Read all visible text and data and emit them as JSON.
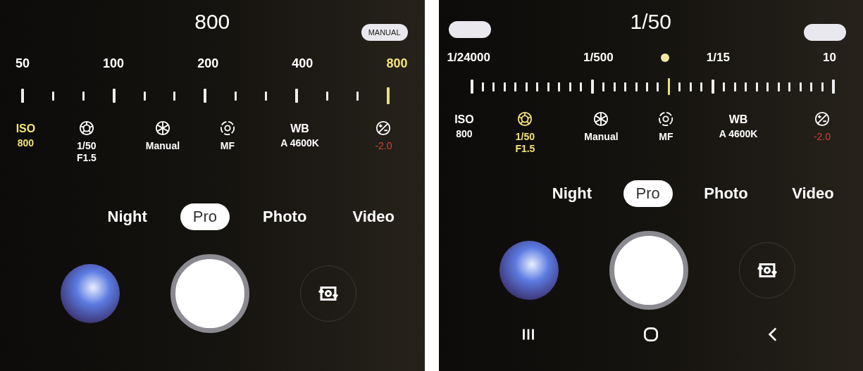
{
  "screens": [
    {
      "title": "800",
      "left_pill": false,
      "right_pill": true,
      "right_pill_label": "MANUAL",
      "scale": {
        "kind": "iso",
        "level": 1.0,
        "labels": [
          {
            "text": "50",
            "selected": false
          },
          {
            "text": "100",
            "selected": false
          },
          {
            "text": "200",
            "selected": false
          },
          {
            "text": "400",
            "selected": false
          },
          {
            "text": "800",
            "selected": true
          }
        ]
      },
      "settings": [
        {
          "kind": "text",
          "label": "ISO",
          "values": [
            "800"
          ],
          "selected": true,
          "alert": false
        },
        {
          "kind": "aperture",
          "values": [
            "1/50",
            "F1.5"
          ],
          "selected": false,
          "alert": false
        },
        {
          "kind": "wheel",
          "values": [
            "Manual"
          ],
          "selected": false,
          "alert": false
        },
        {
          "kind": "focus",
          "values": [
            "MF"
          ],
          "selected": false,
          "alert": false
        },
        {
          "kind": "text",
          "label": "WB",
          "values": [
            "A 4600K"
          ],
          "selected": false,
          "alert": false
        },
        {
          "kind": "exposure",
          "values": [
            "-2.0"
          ],
          "selected": false,
          "alert": true
        }
      ],
      "modes": [
        {
          "label": "Night",
          "selected": false
        },
        {
          "label": "Pro",
          "selected": true
        },
        {
          "label": "Photo",
          "selected": false
        },
        {
          "label": "Video",
          "selected": false
        }
      ],
      "nav_bar": false
    },
    {
      "title": "1/50",
      "left_pill": true,
      "right_pill": true,
      "scale": {
        "kind": "shutter",
        "level": 0.55,
        "labels": [
          {
            "text": "1/24000",
            "selected": false
          },
          {
            "text": "1/500",
            "selected": false
          },
          {
            "text": "1/15",
            "selected": false
          },
          {
            "text": "10",
            "selected": false
          }
        ]
      },
      "settings": [
        {
          "kind": "text",
          "label": "ISO",
          "values": [
            "800"
          ],
          "selected": false,
          "alert": false
        },
        {
          "kind": "aperture",
          "values": [
            "1/50",
            "F1.5"
          ],
          "selected": true,
          "alert": false
        },
        {
          "kind": "wheel",
          "values": [
            "Manual"
          ],
          "selected": false,
          "alert": false
        },
        {
          "kind": "focus",
          "values": [
            "MF"
          ],
          "selected": false,
          "alert": false
        },
        {
          "kind": "text",
          "label": "WB",
          "values": [
            "A 4600K"
          ],
          "selected": false,
          "alert": false
        },
        {
          "kind": "exposure",
          "values": [
            "-2.0"
          ],
          "selected": false,
          "alert": true
        }
      ],
      "modes": [
        {
          "label": "Night",
          "selected": false
        },
        {
          "label": "Pro",
          "selected": true
        },
        {
          "label": "Photo",
          "selected": false
        },
        {
          "label": "Video",
          "selected": false
        }
      ],
      "nav_bar": true
    }
  ]
}
